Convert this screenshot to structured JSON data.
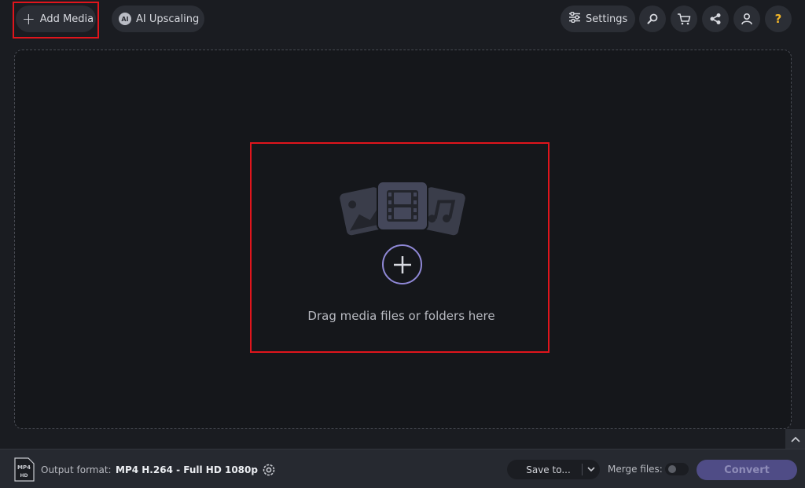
{
  "toolbar": {
    "add_media_label": "Add Media",
    "ai_upscaling_label": "AI Upscaling",
    "ai_badge_text": "AI",
    "settings_label": "Settings",
    "help_symbol": "?"
  },
  "dropzone": {
    "text": "Drag media files or folders here"
  },
  "bottom_bar": {
    "format_icon_top": "MP4",
    "format_icon_bottom": "HD",
    "output_format_label": "Output format:",
    "output_format_value": "MP4 H.264 - Full HD 1080p",
    "save_to_label": "Save to...",
    "merge_files_label": "Merge files:",
    "merge_files_enabled": false,
    "convert_label": "Convert"
  },
  "colors": {
    "background": "#1a1c21",
    "highlight": "#e0151c",
    "accent": "#8f88d6",
    "convert_button": "#4f4c86",
    "help_icon": "#f0b429"
  }
}
